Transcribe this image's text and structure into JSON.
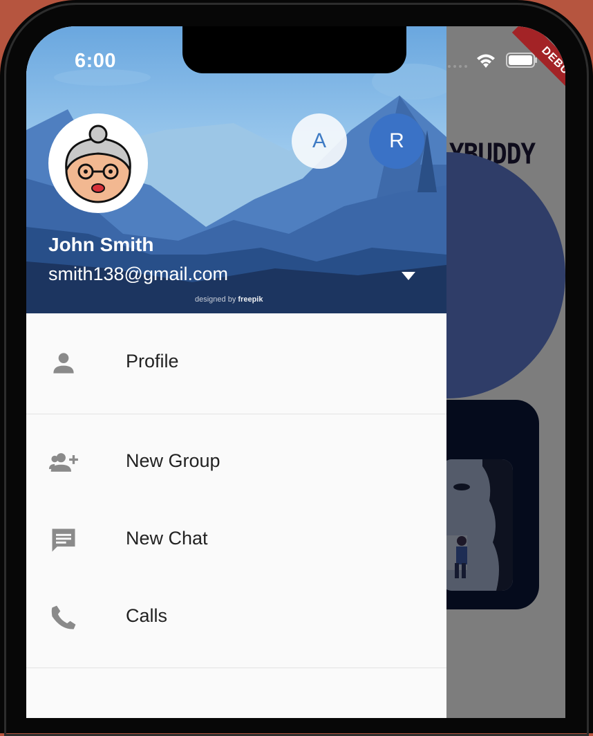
{
  "status_bar": {
    "time": "6:00"
  },
  "debug_banner": "DEBUG",
  "background_app": {
    "title": "YBUDDY"
  },
  "drawer": {
    "header": {
      "account_a_initial": "A",
      "account_r_initial": "R",
      "user_name": "John Smith",
      "user_email": "smith138@gmail.com",
      "credit_prefix": "designed by",
      "credit_brand": "freepik"
    },
    "menu": [
      {
        "label": "Profile",
        "icon": "person-icon"
      },
      {
        "label": "New Group",
        "icon": "group-add-icon"
      },
      {
        "label": "New Chat",
        "icon": "chat-icon"
      },
      {
        "label": "Calls",
        "icon": "phone-icon"
      }
    ]
  },
  "colors": {
    "drawer_bg": "#fafafa",
    "icon": "#8a8a8a",
    "accent_blue": "#3a72c6",
    "debug_red": "#a32326"
  }
}
